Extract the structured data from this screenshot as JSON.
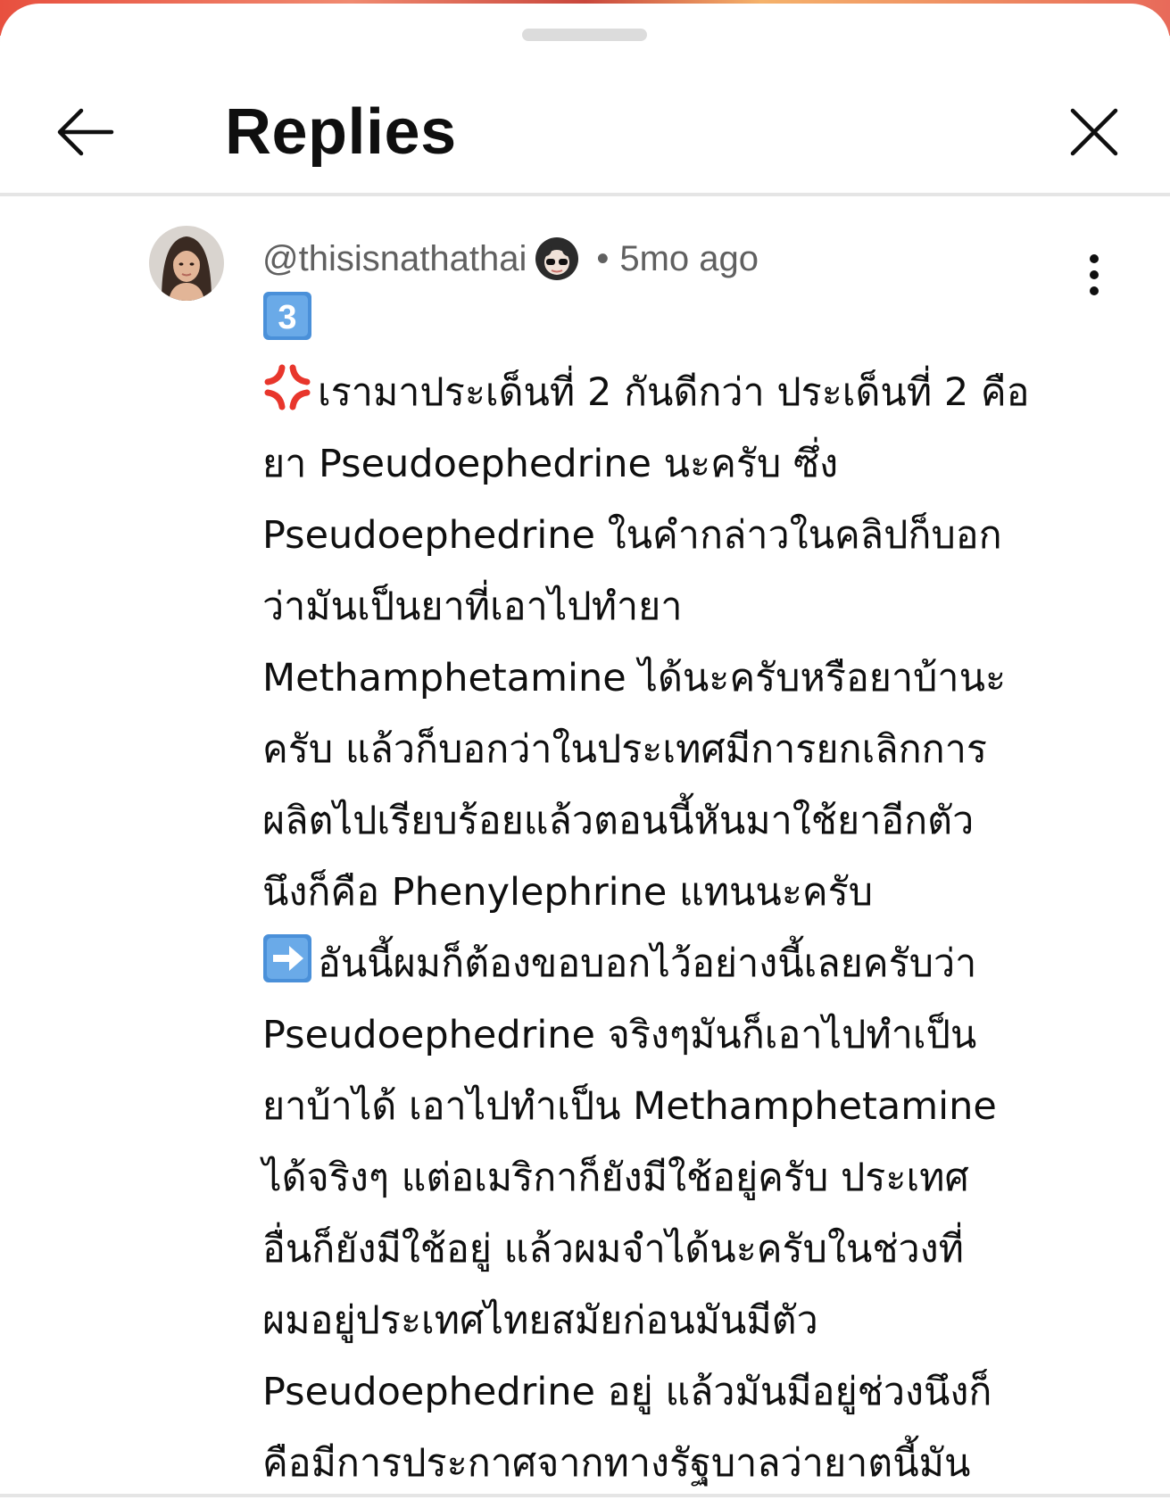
{
  "header": {
    "title": "Replies",
    "back_icon": "arrow-left-icon",
    "close_icon": "close-icon"
  },
  "reply": {
    "username": "@thisisnathathai",
    "separator": "•",
    "timestamp": "5mo ago",
    "more_icon": "more-vertical-icon",
    "keycap_emoji": "keycap-3-icon",
    "anger_emoji": "anger-symbol-icon",
    "arrow_emoji": "right-arrow-emoji-icon",
    "lines": [
      "เรามาประเด็นที่ 2 กันดีกว่า ประเด็นที่ 2 คือ",
      "ยา Pseudoephedrine นะครับ ซึ่ง",
      "Pseudoephedrine ในคำกล่าวในคลิปก็บอก",
      "ว่ามันเป็นยาที่เอาไปทำยา",
      "Methamphetamine ได้นะครับหรือยาบ้านะ",
      "ครับ แล้วก็บอกว่าในประเทศมีการยกเลิกการ",
      "ผลิตไปเรียบร้อยแล้วตอนนี้หันมาใช้ยาอีกตัว",
      "นึงก็คือ Phenylephrine แทนนะครับ",
      "อันนี้ผมก็ต้องขอบอกไว้อย่างนี้เลยครับว่า",
      "Pseudoephedrine จริงๆมันก็เอาไปทำเป็น",
      "ยาบ้าได้ เอาไปทำเป็น Methamphetamine",
      "ได้จริงๆ แต่อเมริกาก็ยังมีใช้อยู่ครับ ประเทศ",
      "อื่นก็ยังมีใช้อยู่ แล้วผมจำได้นะครับในช่วงที่",
      "ผมอยู่ประเทศไทยสมัยก่อนมันมีตัว",
      "Pseudoephedrine อยู่ แล้วมันมีอยู่ช่วงนึงก็",
      "คือมีการประกาศจากทางรัฐบาลว่ายาตนี้มัน"
    ]
  },
  "colors": {
    "text_primary": "#0f0f0f",
    "text_secondary": "#606060",
    "divider": "#e5e5e5",
    "keycap_blue": "#4a90d9",
    "anger_red": "#e8362c"
  }
}
